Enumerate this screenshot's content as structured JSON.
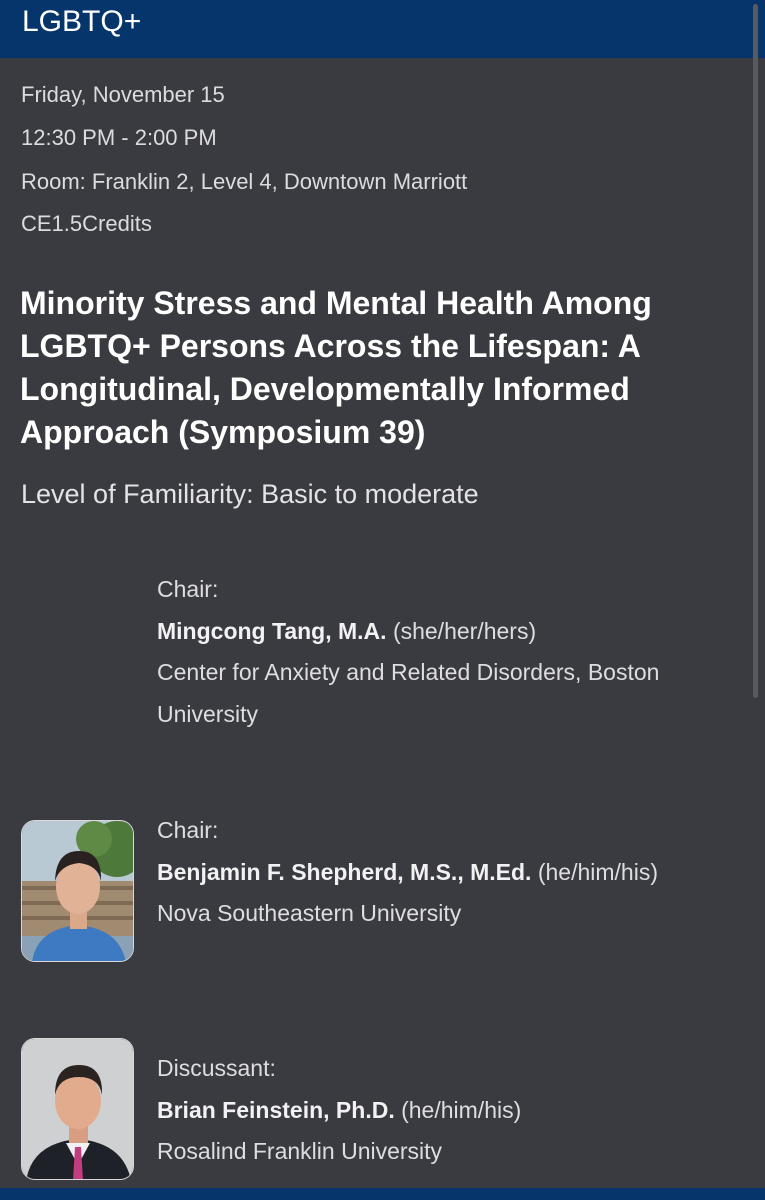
{
  "header": {
    "title": "LGBTQ+"
  },
  "session": {
    "date": "Friday, November 15",
    "time": "12:30 PM - 2:00 PM",
    "room": "Room: Franklin 2, Level 4, Downtown Marriott",
    "credits": "CE1.5Credits",
    "title": "Minority Stress and Mental Health Among LGBTQ+ Persons Across the Lifespan: A Longitudinal, Developmentally Informed Approach (Symposium 39)",
    "familiarity": "Level of Familiarity: Basic to moderate"
  },
  "people": [
    {
      "role": "Chair:",
      "name": "Mingcong Tang, M.A.",
      "pronouns": "(she/her/hers)",
      "affiliation": "Center for Anxiety and Related Disorders, Boston University"
    },
    {
      "role": "Chair:",
      "name": "Benjamin F. Shepherd, M.S., M.Ed.",
      "pronouns": "(he/him/his)",
      "affiliation": "Nova Southeastern University"
    },
    {
      "role": "Discussant:",
      "name": "Brian Feinstein, Ph.D.",
      "pronouns": "(he/him/his)",
      "affiliation": "Rosalind Franklin University"
    }
  ],
  "colors": {
    "header_bg": "#06356b",
    "page_bg": "#3a3b40"
  }
}
